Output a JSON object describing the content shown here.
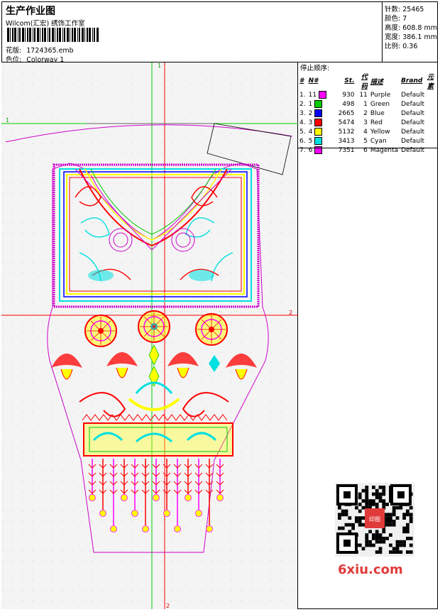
{
  "header": {
    "title": "生产作业图",
    "company": "Wilcom(汇宏) 绣饰工作室",
    "design_label": "花版:",
    "design_value": "1724365.emb",
    "colorway_label": "色位:",
    "colorway_value": "Colorway 1"
  },
  "stats": [
    {
      "label": "针数:",
      "value": "25465"
    },
    {
      "label": "颜色:",
      "value": "7"
    },
    {
      "label": "高度:",
      "value": "608.8 mm"
    },
    {
      "label": "宽度:",
      "value": "386.1 mm"
    },
    {
      "label": "比例:",
      "value": "0.36"
    }
  ],
  "stop_sequence": {
    "title": "停止顺序:",
    "columns": [
      "#",
      "N#",
      "St.",
      "代码",
      "描述",
      "Brand",
      "元素"
    ],
    "rows": [
      {
        "idx": "1.",
        "n": "11",
        "color": "#ff00ff",
        "st": "930",
        "code": "11",
        "desc": "Purple",
        "brand": "Default"
      },
      {
        "idx": "2.",
        "n": "1",
        "color": "#00cc00",
        "st": "498",
        "code": "1",
        "desc": "Green",
        "brand": "Default"
      },
      {
        "idx": "3.",
        "n": "2",
        "color": "#0000ff",
        "st": "2665",
        "code": "2",
        "desc": "Blue",
        "brand": "Default"
      },
      {
        "idx": "4.",
        "n": "3",
        "color": "#ff0000",
        "st": "5474",
        "code": "3",
        "desc": "Red",
        "brand": "Default"
      },
      {
        "idx": "5.",
        "n": "4",
        "color": "#ffff00",
        "st": "5132",
        "code": "4",
        "desc": "Yellow",
        "brand": "Default"
      },
      {
        "idx": "6.",
        "n": "5",
        "color": "#00e0e0",
        "st": "3413",
        "code": "5",
        "desc": "Cyan",
        "brand": "Default"
      },
      {
        "idx": "7.",
        "n": "6",
        "color": "#ff00ff",
        "st": "7351",
        "code": "6",
        "desc": "Magenta",
        "brand": "Default"
      }
    ]
  },
  "guides": {
    "v1": "1",
    "h1": "1",
    "h2": "2",
    "v2": "2"
  },
  "watermark": {
    "logo": "6xiu.com",
    "seal": "印图"
  },
  "colors": {
    "purple": "#cc00cc",
    "green": "#00cc00",
    "blue": "#0000ff",
    "red": "#ff0000",
    "yellow": "#ffff00",
    "cyan": "#00e0e0",
    "magenta": "#ff00ff"
  }
}
